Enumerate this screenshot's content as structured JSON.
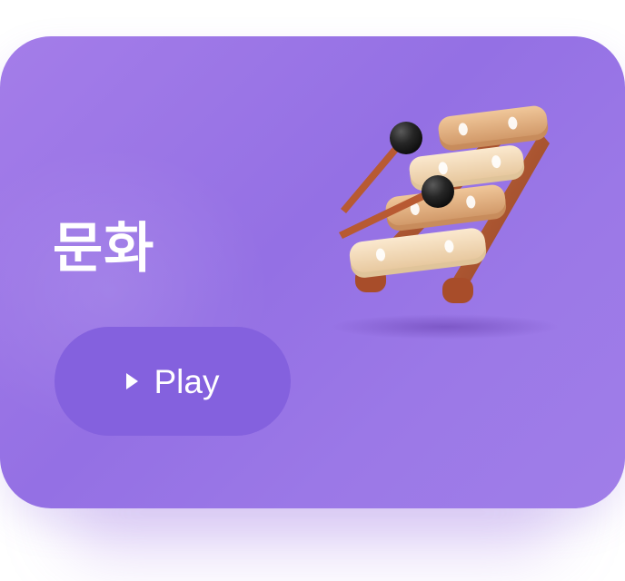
{
  "card": {
    "title": "문화",
    "play_label": "Play",
    "illustration_icon": "xylophone-icon",
    "play_icon": "play-triangle-icon"
  },
  "colors": {
    "card_background": "#9b78e7",
    "button_background": "#8461de",
    "text": "#ffffff"
  }
}
